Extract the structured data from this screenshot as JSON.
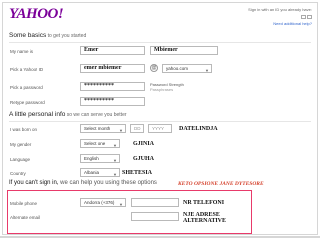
{
  "header": {
    "logo": "YAHOO!",
    "signin_line": "Sign in with an ID you already have:",
    "help_link": "Need additional help?"
  },
  "sections": {
    "basics_title": "Some basics",
    "basics_sub": " to get you started",
    "personal_title": "A little personal info",
    "personal_sub": " so we can serve you better",
    "signin_warn": "If you can't sign in,",
    "signin_warn_rest": " we can help you using these options"
  },
  "form": {
    "name_label": "My name is",
    "first_name": "Emer",
    "last_name": "Mbiemer",
    "yahoo_id_label": "Pick a Yahoo! ID",
    "yahoo_id": "emer mbiemer",
    "domain": "yahoo.com",
    "password_label": "Pick a password",
    "password": "**********",
    "password_strength_label": "Password Strength",
    "password_strength_value": "Passphrases",
    "retype_label": "Retype password",
    "retype": "**********",
    "born_label": "I was born on",
    "month": "Select month",
    "day": "DD",
    "year": "YYYY",
    "gender_label": "My gender",
    "gender": "Select one",
    "language_label": "Language",
    "language": "English",
    "country_label": "Country",
    "country": "Albania",
    "mobile_label": "Mobile phone",
    "mobile_code": "Andorra (+376)",
    "alt_email_label": "Alternate email"
  },
  "annotations": {
    "birth": "DATELINDJA",
    "gender": "GJINIA",
    "language": "GJUHA",
    "country": "SHETESIA",
    "optional": "KETO OPSIONE JANE DYTESORE",
    "phone": "NR TELEFONI",
    "email_line1": "NJE ADRESE",
    "email_line2": "ALTERNATIVE"
  },
  "colors": {
    "brand": "#7b0099",
    "highlight_box": "#e83a6a",
    "annotation_red": "#d4402b"
  }
}
